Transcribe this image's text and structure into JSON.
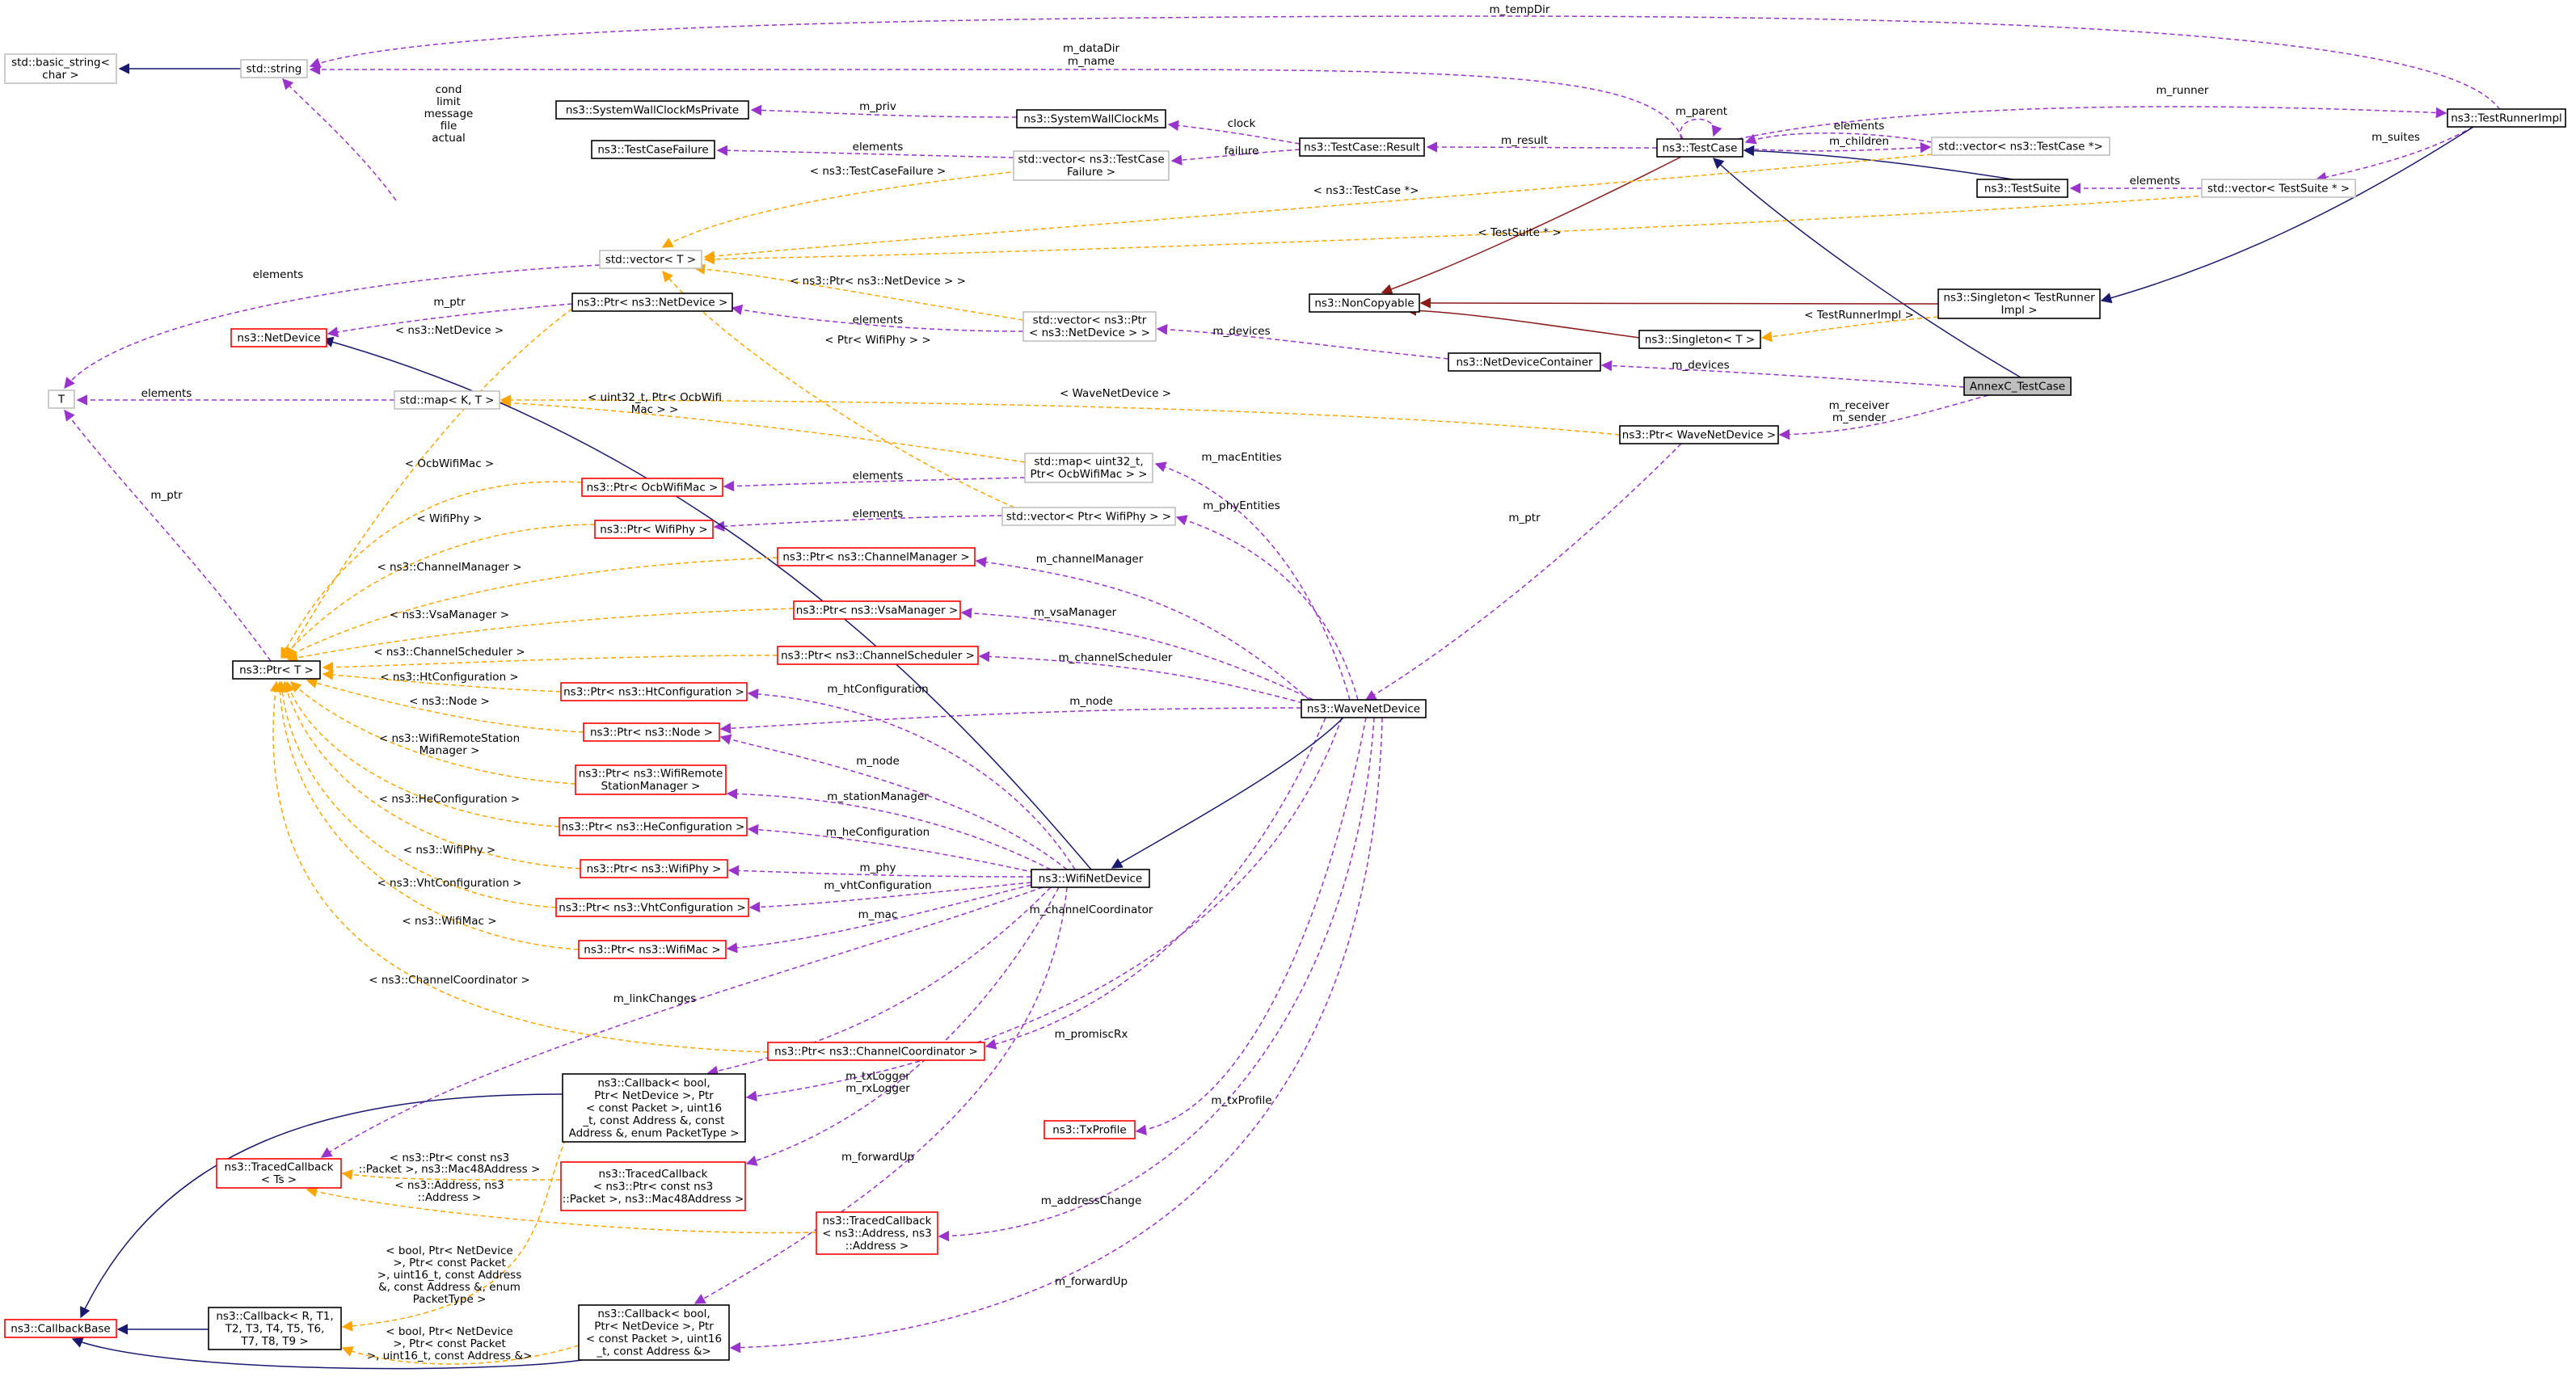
{
  "colors": {
    "member": "#9a32cd",
    "template": "#ffa500",
    "inherit": "#191970",
    "private_inherit": "#8b1a1a",
    "box_link": "#000000",
    "box_doc_missing": "#ff0000",
    "box_external": "#bfbfbf",
    "focus_fill": "#bfbfbf"
  },
  "nodes": [
    {
      "id": "basic_string",
      "lines": [
        "std::basic_string<",
        "char >"
      ],
      "style": "external"
    },
    {
      "id": "string",
      "lines": [
        "std::string"
      ],
      "style": "external"
    },
    {
      "id": "sys_priv",
      "lines": [
        "ns3::SystemWallClockMsPrivate"
      ],
      "style": "link"
    },
    {
      "id": "sys_clock",
      "lines": [
        "ns3::SystemWallClockMs"
      ],
      "style": "link"
    },
    {
      "id": "tc_failure",
      "lines": [
        "ns3::TestCaseFailure"
      ],
      "style": "link"
    },
    {
      "id": "vec_tcfail",
      "lines": [
        "std::vector< ns3::TestCase",
        "Failure >"
      ],
      "style": "external"
    },
    {
      "id": "tc_result",
      "lines": [
        "ns3::TestCase::Result"
      ],
      "style": "link"
    },
    {
      "id": "testcase",
      "lines": [
        "ns3::TestCase"
      ],
      "style": "link"
    },
    {
      "id": "vec_tc",
      "lines": [
        "std::vector< ns3::TestCase *>"
      ],
      "style": "external"
    },
    {
      "id": "runner",
      "lines": [
        "ns3::TestRunnerImpl"
      ],
      "style": "link"
    },
    {
      "id": "testsuite",
      "lines": [
        "ns3::TestSuite"
      ],
      "style": "link"
    },
    {
      "id": "vec_ts",
      "lines": [
        "std::vector< TestSuite * >"
      ],
      "style": "external"
    },
    {
      "id": "vec_T",
      "lines": [
        "std::vector< T >"
      ],
      "style": "external"
    },
    {
      "id": "ptr_netdev",
      "lines": [
        "ns3::Ptr< ns3::NetDevice >"
      ],
      "style": "link"
    },
    {
      "id": "netdevice",
      "lines": [
        "ns3::NetDevice"
      ],
      "style": "missing"
    },
    {
      "id": "vec_ptrnd",
      "lines": [
        "std::vector< ns3::Ptr",
        "< ns3::NetDevice > >"
      ],
      "style": "external"
    },
    {
      "id": "noncopyable",
      "lines": [
        "ns3::NonCopyable"
      ],
      "style": "link"
    },
    {
      "id": "singleton_runner",
      "lines": [
        "ns3::Singleton< TestRunner",
        "Impl >"
      ],
      "style": "link"
    },
    {
      "id": "singleton_T",
      "lines": [
        "ns3::Singleton< T >"
      ],
      "style": "link"
    },
    {
      "id": "ndc",
      "lines": [
        "ns3::NetDeviceContainer"
      ],
      "style": "link"
    },
    {
      "id": "annexc",
      "lines": [
        "AnnexC_TestCase"
      ],
      "style": "focus"
    },
    {
      "id": "T",
      "lines": [
        "T"
      ],
      "style": "external"
    },
    {
      "id": "map_KT",
      "lines": [
        "std::map< K, T >"
      ],
      "style": "external"
    },
    {
      "id": "ptr_wave",
      "lines": [
        "ns3::Ptr< WaveNetDevice >"
      ],
      "style": "link"
    },
    {
      "id": "map_ocb",
      "lines": [
        "std::map< uint32_t,",
        "Ptr< OcbWifiMac > >"
      ],
      "style": "external"
    },
    {
      "id": "ptr_ocb",
      "lines": [
        "ns3::Ptr< OcbWifiMac >"
      ],
      "style": "missing"
    },
    {
      "id": "vec_phy",
      "lines": [
        "std::vector< Ptr< WifiPhy > >"
      ],
      "style": "external"
    },
    {
      "id": "ptr_wifiphy",
      "lines": [
        "ns3::Ptr< WifiPhy >"
      ],
      "style": "missing"
    },
    {
      "id": "ptr_chmgr",
      "lines": [
        "ns3::Ptr< ns3::ChannelManager >"
      ],
      "style": "missing"
    },
    {
      "id": "ptr_vsa",
      "lines": [
        "ns3::Ptr< ns3::VsaManager >"
      ],
      "style": "missing"
    },
    {
      "id": "ptr_T",
      "lines": [
        "ns3::Ptr< T >"
      ],
      "style": "link"
    },
    {
      "id": "ptr_chsched",
      "lines": [
        "ns3::Ptr< ns3::ChannelScheduler >"
      ],
      "style": "missing"
    },
    {
      "id": "ptr_htconf",
      "lines": [
        "ns3::Ptr< ns3::HtConfiguration >"
      ],
      "style": "missing"
    },
    {
      "id": "wave",
      "lines": [
        "ns3::WaveNetDevice"
      ],
      "style": "link"
    },
    {
      "id": "ptr_node",
      "lines": [
        "ns3::Ptr< ns3::Node >"
      ],
      "style": "missing"
    },
    {
      "id": "ptr_wrsm",
      "lines": [
        "ns3::Ptr< ns3::WifiRemote",
        "StationManager >"
      ],
      "style": "missing"
    },
    {
      "id": "ptr_heconf",
      "lines": [
        "ns3::Ptr< ns3::HeConfiguration >"
      ],
      "style": "missing"
    },
    {
      "id": "ptr_wifiphy2",
      "lines": [
        "ns3::Ptr< ns3::WifiPhy >"
      ],
      "style": "missing"
    },
    {
      "id": "wifinetdev",
      "lines": [
        "ns3::WifiNetDevice"
      ],
      "style": "link"
    },
    {
      "id": "ptr_vhtconf",
      "lines": [
        "ns3::Ptr< ns3::VhtConfiguration >"
      ],
      "style": "missing"
    },
    {
      "id": "ptr_wifimac",
      "lines": [
        "ns3::Ptr< ns3::WifiMac >"
      ],
      "style": "missing"
    },
    {
      "id": "ptr_chcoord",
      "lines": [
        "ns3::Ptr< ns3::ChannelCoordinator >"
      ],
      "style": "missing"
    },
    {
      "id": "cb_promisc",
      "lines": [
        "ns3::Callback< bool,",
        "Ptr< NetDevice >, Ptr",
        "< const Packet >, uint16",
        "_t, const Address &, const",
        "Address &, enum PacketType >"
      ],
      "style": "link"
    },
    {
      "id": "txprofile",
      "lines": [
        "ns3::TxProfile"
      ],
      "style": "missing"
    },
    {
      "id": "traced_ts",
      "lines": [
        "ns3::TracedCallback",
        "< Ts >"
      ],
      "style": "missing"
    },
    {
      "id": "traced_pkt",
      "lines": [
        "ns3::TracedCallback",
        "< ns3::Ptr< const ns3",
        "::Packet >, ns3::Mac48Address >"
      ],
      "style": "missing"
    },
    {
      "id": "traced_addr",
      "lines": [
        "ns3::TracedCallback",
        "< ns3::Address, ns3",
        "::Address >"
      ],
      "style": "missing"
    },
    {
      "id": "cbbase",
      "lines": [
        "ns3::CallbackBase"
      ],
      "style": "missing"
    },
    {
      "id": "cb_generic",
      "lines": [
        "ns3::Callback< R, T1,",
        "T2, T3, T4, T5, T6,",
        "T7, T8, T9 >"
      ],
      "style": "link"
    },
    {
      "id": "cb_fwd",
      "lines": [
        "ns3::Callback< bool,",
        "Ptr< NetDevice >, Ptr",
        "< const Packet >, uint16",
        "_t, const Address &>"
      ],
      "style": "link"
    }
  ],
  "edges": [
    {
      "id": "e_tempdir",
      "kind": "member",
      "label": [
        "m_tempDir"
      ]
    },
    {
      "id": "e_dataname",
      "kind": "member",
      "label": [
        "m_dataDir",
        "m_name"
      ]
    },
    {
      "id": "e_cond",
      "kind": "member",
      "label": [
        "cond",
        "limit",
        "message",
        "file",
        "actual"
      ]
    },
    {
      "id": "e_basic",
      "kind": "inherit",
      "label": []
    },
    {
      "id": "e_priv",
      "kind": "member",
      "label": [
        "m_priv"
      ]
    },
    {
      "id": "e_clock",
      "kind": "member",
      "label": [
        "clock"
      ]
    },
    {
      "id": "e_failure",
      "kind": "member",
      "label": [
        "failure"
      ]
    },
    {
      "id": "e_tcfail_el",
      "kind": "member",
      "label": [
        "elements"
      ]
    },
    {
      "id": "e_result",
      "kind": "member",
      "label": [
        "m_result"
      ]
    },
    {
      "id": "e_parent",
      "kind": "member",
      "label": [
        "m_parent"
      ]
    },
    {
      "id": "e_runner",
      "kind": "member",
      "label": [
        "m_runner"
      ]
    },
    {
      "id": "e_tc_el",
      "kind": "member",
      "label": [
        "elements"
      ]
    },
    {
      "id": "e_children",
      "kind": "member",
      "label": [
        "m_children"
      ]
    },
    {
      "id": "e_suites",
      "kind": "member",
      "label": [
        "m_suites"
      ]
    },
    {
      "id": "e_ts_el",
      "kind": "member",
      "label": [
        "elements"
      ]
    },
    {
      "id": "e_ts_inh",
      "kind": "inherit",
      "label": []
    },
    {
      "id": "e_annexc_inh",
      "kind": "inherit",
      "label": []
    },
    {
      "id": "e_tc_noncopy",
      "kind": "private_inherit",
      "label": []
    },
    {
      "id": "e_vecT_tcfail",
      "kind": "template",
      "label": [
        "< ns3::TestCaseFailure >"
      ]
    },
    {
      "id": "e_vecT_tc",
      "kind": "template",
      "label": [
        "< ns3::TestCase *>"
      ]
    },
    {
      "id": "e_vecT_ts",
      "kind": "template",
      "label": [
        "< TestSuite * >"
      ]
    },
    {
      "id": "e_vecT_ptrnd",
      "kind": "template",
      "label": [
        "< ns3::Ptr< ns3::NetDevice > >"
      ]
    },
    {
      "id": "e_vecT_phy",
      "kind": "template",
      "label": [
        "< Ptr< WifiPhy > >"
      ]
    },
    {
      "id": "e_vecT_elements",
      "kind": "member",
      "label": [
        "elements"
      ]
    },
    {
      "id": "e_ptrnd_el",
      "kind": "member",
      "label": [
        "elements"
      ]
    },
    {
      "id": "e_ptrnd_mptr",
      "kind": "member",
      "label": [
        "m_ptr"
      ]
    },
    {
      "id": "e_devices1",
      "kind": "member",
      "label": [
        "m_devices"
      ]
    },
    {
      "id": "e_devices2",
      "kind": "member",
      "label": [
        "m_devices"
      ]
    },
    {
      "id": "e_single_runner",
      "kind": "inherit",
      "label": []
    },
    {
      "id": "e_noncopy_srunner",
      "kind": "private_inherit",
      "label": []
    },
    {
      "id": "e_noncopy_sT",
      "kind": "private_inherit",
      "label": []
    },
    {
      "id": "e_sT_runner",
      "kind": "template",
      "label": [
        "< TestRunnerImpl >"
      ]
    },
    {
      "id": "e_map_el",
      "kind": "member",
      "label": [
        "elements"
      ]
    },
    {
      "id": "e_T_mptr",
      "kind": "member",
      "label": [
        "m_ptr"
      ]
    },
    {
      "id": "e_receiver",
      "kind": "member",
      "label": [
        "m_receiver",
        "m_sender"
      ]
    },
    {
      "id": "e_ptrwave_mptr",
      "kind": "member",
      "label": [
        "m_ptr"
      ]
    },
    {
      "id": "e_mapKT_ocb",
      "kind": "template",
      "label": [
        "< uint32_t, Ptr< OcbWifi",
        "Mac > >"
      ]
    },
    {
      "id": "e_mapKT_wave",
      "kind": "template",
      "label": [
        "< WaveNetDevice >"
      ]
    },
    {
      "id": "e_ocb_el",
      "kind": "member",
      "label": [
        "elements"
      ]
    },
    {
      "id": "e_phy_el",
      "kind": "member",
      "label": [
        "elements"
      ]
    },
    {
      "id": "e_macEntities",
      "kind": "member",
      "label": [
        "m_macEntities"
      ]
    },
    {
      "id": "e_phyEntities",
      "kind": "member",
      "label": [
        "m_phyEntities"
      ]
    },
    {
      "id": "e_chmgr",
      "kind": "member",
      "label": [
        "m_channelManager"
      ]
    },
    {
      "id": "e_vsa",
      "kind": "member",
      "label": [
        "m_vsaManager"
      ]
    },
    {
      "id": "e_chsched",
      "kind": "member",
      "label": [
        "m_channelScheduler"
      ]
    },
    {
      "id": "e_node_wave",
      "kind": "member",
      "label": [
        "m_node"
      ]
    },
    {
      "id": "e_ht",
      "kind": "member",
      "label": [
        "m_htConfiguration"
      ]
    },
    {
      "id": "e_node_wifi",
      "kind": "member",
      "label": [
        "m_node"
      ]
    },
    {
      "id": "e_station",
      "kind": "member",
      "label": [
        "m_stationManager"
      ]
    },
    {
      "id": "e_he",
      "kind": "member",
      "label": [
        "m_heConfiguration"
      ]
    },
    {
      "id": "e_phy",
      "kind": "member",
      "label": [
        "m_phy"
      ]
    },
    {
      "id": "e_vht",
      "kind": "member",
      "label": [
        "m_vhtConfiguration"
      ]
    },
    {
      "id": "e_mac",
      "kind": "member",
      "label": [
        "m_mac"
      ]
    },
    {
      "id": "e_chcoord",
      "kind": "member",
      "label": [
        "m_channelCoordinator"
      ]
    },
    {
      "id": "e_linkchanges",
      "kind": "member",
      "label": [
        "m_linkChanges"
      ]
    },
    {
      "id": "e_promisc_wifi",
      "kind": "member",
      "label": [
        "m_promiscRx"
      ]
    },
    {
      "id": "e_promisc_wave",
      "kind": "member",
      "label": [
        "m_promiscRx"
      ]
    },
    {
      "id": "e_txrxlogger",
      "kind": "member",
      "label": [
        "m_txLogger",
        "m_rxLogger"
      ]
    },
    {
      "id": "e_txprofile",
      "kind": "member",
      "label": [
        "m_txProfile"
      ]
    },
    {
      "id": "e_fwd_wifi",
      "kind": "member",
      "label": [
        "m_forwardUp"
      ]
    },
    {
      "id": "e_addrchange",
      "kind": "member",
      "label": [
        "m_addressChange"
      ]
    },
    {
      "id": "e_fwd_wave",
      "kind": "member",
      "label": [
        "m_forwardUp"
      ]
    },
    {
      "id": "e_wifi_inh",
      "kind": "inherit",
      "label": []
    },
    {
      "id": "e_wave_inh",
      "kind": "inherit",
      "label": []
    },
    {
      "id": "e_cb_inh1",
      "kind": "inherit",
      "label": []
    },
    {
      "id": "e_cb_inh2",
      "kind": "inherit",
      "label": []
    },
    {
      "id": "e_cb_inh3",
      "kind": "inherit",
      "label": []
    },
    {
      "id": "e_ptrT_netdev",
      "kind": "template",
      "label": [
        "< ns3::NetDevice >"
      ]
    },
    {
      "id": "e_ptrT_ocb",
      "kind": "template",
      "label": [
        "< OcbWifiMac >"
      ]
    },
    {
      "id": "e_ptrT_wifiphy",
      "kind": "template",
      "label": [
        "< WifiPhy >"
      ]
    },
    {
      "id": "e_ptrT_chmgr",
      "kind": "template",
      "label": [
        "< ns3::ChannelManager >"
      ]
    },
    {
      "id": "e_ptrT_vsa",
      "kind": "template",
      "label": [
        "< ns3::VsaManager >"
      ]
    },
    {
      "id": "e_ptrT_chsched",
      "kind": "template",
      "label": [
        "< ns3::ChannelScheduler >"
      ]
    },
    {
      "id": "e_ptrT_ht",
      "kind": "template",
      "label": [
        "< ns3::HtConfiguration >"
      ]
    },
    {
      "id": "e_ptrT_node",
      "kind": "template",
      "label": [
        "< ns3::Node >"
      ]
    },
    {
      "id": "e_ptrT_wrsm",
      "kind": "template",
      "label": [
        "< ns3::WifiRemoteStation",
        "Manager >"
      ]
    },
    {
      "id": "e_ptrT_he",
      "kind": "template",
      "label": [
        "< ns3::HeConfiguration >"
      ]
    },
    {
      "id": "e_ptrT_phy2",
      "kind": "template",
      "label": [
        "< ns3::WifiPhy >"
      ]
    },
    {
      "id": "e_ptrT_vht",
      "kind": "template",
      "label": [
        "< ns3::VhtConfiguration >"
      ]
    },
    {
      "id": "e_ptrT_mac",
      "kind": "template",
      "label": [
        "< ns3::WifiMac >"
      ]
    },
    {
      "id": "e_ptrT_coord",
      "kind": "template",
      "label": [
        "< ns3::ChannelCoordinator >"
      ]
    },
    {
      "id": "e_traced_pkt",
      "kind": "template",
      "label": [
        "< ns3::Ptr< const ns3",
        "::Packet >, ns3::Mac48Address >"
      ]
    },
    {
      "id": "e_traced_addr",
      "kind": "template",
      "label": [
        "< ns3::Address, ns3",
        "::Address >"
      ]
    },
    {
      "id": "e_cb_promisc_t",
      "kind": "template",
      "label": [
        "< bool, Ptr< NetDevice",
        ">, Ptr< const Packet",
        ">, uint16_t, const Address",
        "&, const Address &, enum",
        "PacketType >"
      ]
    },
    {
      "id": "e_cb_fwd_t",
      "kind": "template",
      "label": [
        "< bool, Ptr< NetDevice",
        ">, Ptr< const Packet",
        ">, uint16_t, const Address &>"
      ]
    }
  ]
}
